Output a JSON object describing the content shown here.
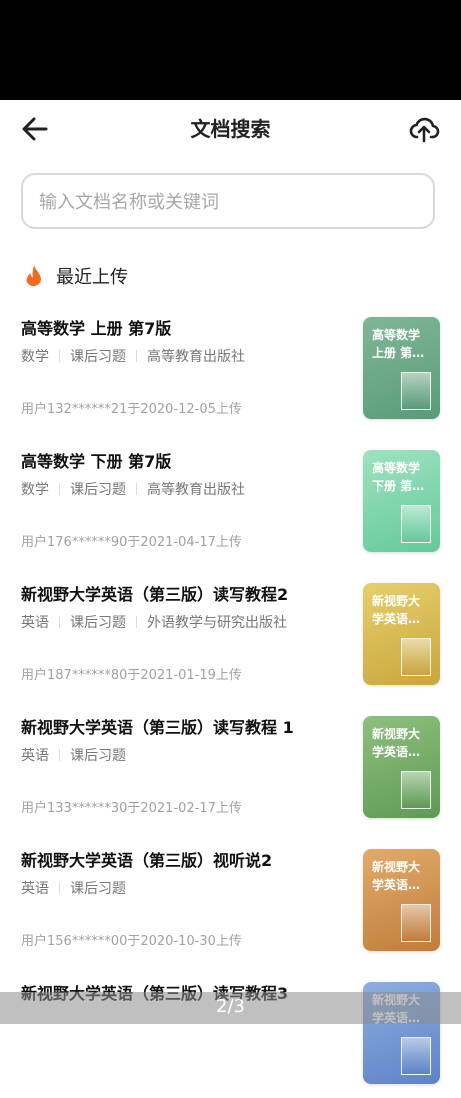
{
  "header": {
    "title": "文档搜索",
    "back_icon": "arrow-left-icon",
    "upload_icon": "cloud-upload-icon"
  },
  "search": {
    "placeholder": "输入文档名称或关键词",
    "value": ""
  },
  "section": {
    "title": "最近上传",
    "icon": "fire-icon",
    "icon_color": "#f26b21"
  },
  "documents": [
    {
      "title": "高等数学 上册 第7版",
      "tags": [
        "数学",
        "课后习题",
        "高等教育出版社"
      ],
      "meta": "用户132******21于2020-12-05上传",
      "cover_text": "高等数学 上册 第…",
      "cover_colors": [
        "#7fb795",
        "#5a9b7a"
      ]
    },
    {
      "title": "高等数学 下册 第7版",
      "tags": [
        "数学",
        "课后习题",
        "高等教育出版社"
      ],
      "meta": "用户176******90于2021-04-17上传",
      "cover_text": "高等数学 下册 第…",
      "cover_colors": [
        "#9fe2c0",
        "#64c99b"
      ]
    },
    {
      "title": "新视野大学英语（第三版）读写教程2",
      "tags": [
        "英语",
        "课后习题",
        "外语教学与研究出版社"
      ],
      "meta": "用户187******80于2021-01-19上传",
      "cover_text": "新视野大 学英语…",
      "cover_colors": [
        "#e6cf6b",
        "#c9a63e"
      ]
    },
    {
      "title": "新视野大学英语（第三版）读写教程 1",
      "tags": [
        "英语",
        "课后习题"
      ],
      "meta": "用户133******30于2021-02-17上传",
      "cover_text": "新视野大 学英语…",
      "cover_colors": [
        "#8fbf7e",
        "#5f9a55"
      ]
    },
    {
      "title": "新视野大学英语（第三版）视听说2",
      "tags": [
        "英语",
        "课后习题"
      ],
      "meta": "用户156******00于2020-10-30上传",
      "cover_text": "新视野大 学英语…",
      "cover_colors": [
        "#e2ab6a",
        "#c07d3c"
      ]
    },
    {
      "title": "新视野大学英语（第三版）读写教程3",
      "tags": [],
      "meta": "",
      "cover_text": "新视野大 学英语…",
      "cover_colors": [
        "#8eaee0",
        "#5e83c6"
      ]
    }
  ],
  "pagination": {
    "label": "2/3"
  }
}
